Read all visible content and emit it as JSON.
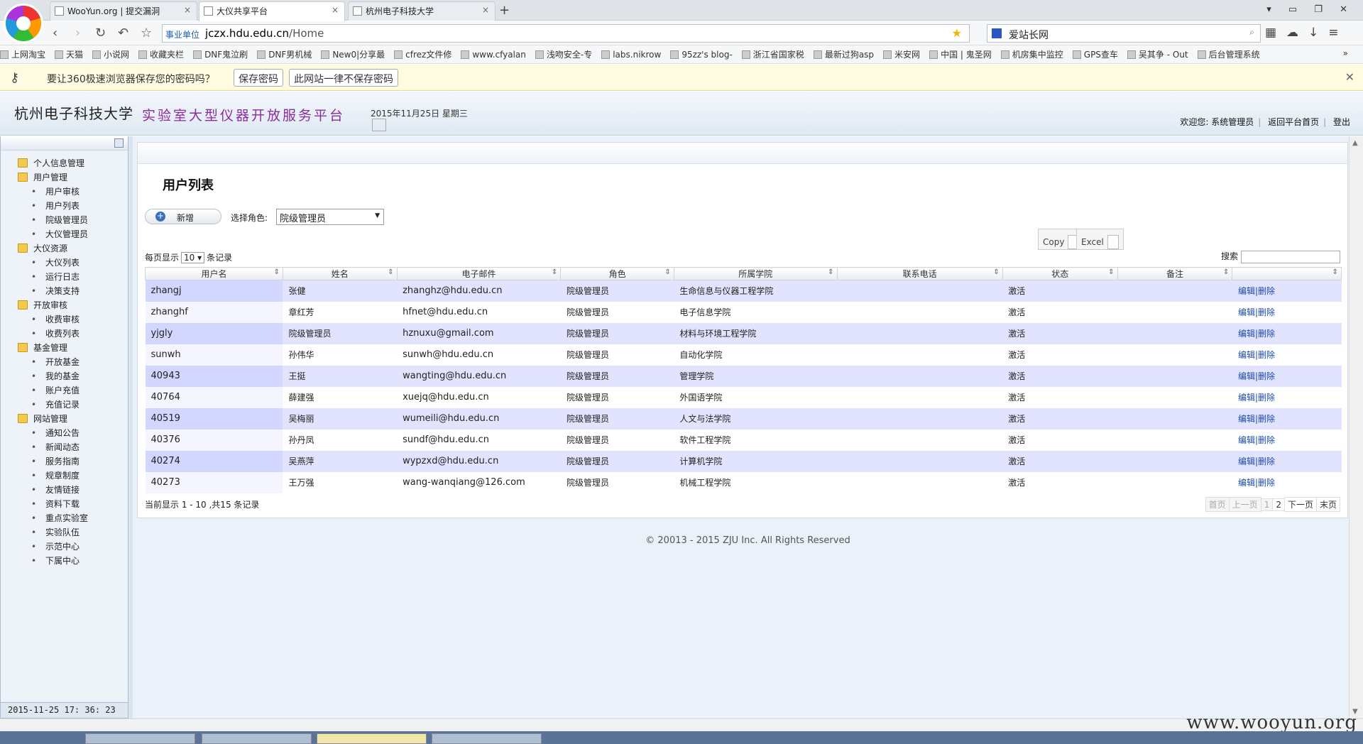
{
  "browser": {
    "tabs": [
      {
        "title": "WooYun.org | 提交漏洞"
      },
      {
        "title": "大仪共享平台"
      },
      {
        "title": "杭州电子科技大学"
      }
    ],
    "url_tag": "事业单位",
    "url_host": "jczx.hdu.edu.cn",
    "url_path": "/Home",
    "search_text": "爱站长网",
    "bookmarks": [
      "上网淘宝",
      "天猫",
      "小说网",
      "收藏夹栏",
      "DNF鬼泣刷",
      "DNF男机械",
      "New0|分享最",
      "cfrez文件修",
      "www.cfyalan",
      "浅吻安全-专",
      "labs.nikrow",
      "95zz's blog-",
      "浙江省国家税",
      "最新过狗asp",
      "米安网",
      "中国 | 鬼圣网",
      "机房集中监控",
      "GPS查车",
      "吴其争 - Out",
      "后台管理系统"
    ],
    "pwd_prompt": "要让360极速浏览器保存您的密码吗？",
    "pwd_save": "保存密码",
    "pwd_never": "此网站一律不保存密码",
    "colors": {
      "tab_bar": "#dfe3e8",
      "prompt_bg": "#fffbe1",
      "row_odd": "#e2e4ff",
      "title_purple": "#8a2d9b"
    }
  },
  "header": {
    "school": "杭州电子科技大学",
    "platform": "实验室大型仪器开放服务平台",
    "date": "2015年11月25日 星期三",
    "welcome": "欢迎您: 系统管理员",
    "home": "返回平台首页",
    "logout": "登出"
  },
  "sidebar": {
    "groups": [
      {
        "label": "个人信息管理",
        "items": []
      },
      {
        "label": "用户管理",
        "items": [
          "用户审核",
          "用户列表",
          "院级管理员",
          "大仪管理员"
        ]
      },
      {
        "label": "大仪资源",
        "items": [
          "大仪列表",
          "运行日志",
          "决策支持"
        ]
      },
      {
        "label": "开放审核",
        "items": [
          "收费审核",
          "收费列表"
        ]
      },
      {
        "label": "基金管理",
        "items": [
          "开放基金",
          "我的基金",
          "账户充值",
          "充值记录"
        ]
      },
      {
        "label": "网站管理",
        "items": [
          "通知公告",
          "新闻动态",
          "服务指南",
          "规章制度",
          "友情链接",
          "资料下载",
          "重点实验室",
          "实验队伍",
          "示范中心",
          "下属中心"
        ]
      }
    ],
    "clock": "2015-11-25   17: 36: 23"
  },
  "main": {
    "title": "用户列表",
    "add_label": "新增",
    "role_label": "选择角色:",
    "role_value": "院级管理员",
    "copy_label": "Copy",
    "excel_label": "Excel",
    "page_len_prefix": "每页显示",
    "page_len_value": "10",
    "page_len_suffix": "条记录",
    "search_label": "搜索",
    "columns": [
      "用户名",
      "姓名",
      "电子邮件",
      "角色",
      "所属学院",
      "联系电话",
      "状态",
      "备注",
      ""
    ],
    "rows": [
      [
        "zhangj",
        "张健",
        "zhanghz@hdu.edu.cn",
        "院级管理员",
        "生命信息与仪器工程学院",
        "",
        "激活",
        "",
        "编辑|删除"
      ],
      [
        "zhanghf",
        "章红芳",
        "hfnet@hdu.edu.cn",
        "院级管理员",
        "电子信息学院",
        "",
        "激活",
        "",
        "编辑|删除"
      ],
      [
        "yjgly",
        "院级管理员",
        "hznuxu@gmail.com",
        "院级管理员",
        "材料与环境工程学院",
        "",
        "激活",
        "",
        "编辑|删除"
      ],
      [
        "sunwh",
        "孙伟华",
        "sunwh@hdu.edu.cn",
        "院级管理员",
        "自动化学院",
        "",
        "激活",
        "",
        "编辑|删除"
      ],
      [
        "40943",
        "王挺",
        "wangting@hdu.edu.cn",
        "院级管理员",
        "管理学院",
        "",
        "激活",
        "",
        "编辑|删除"
      ],
      [
        "40764",
        "薛建强",
        "xuejq@hdu.edu.cn",
        "院级管理员",
        "外国语学院",
        "",
        "激活",
        "",
        "编辑|删除"
      ],
      [
        "40519",
        "吴梅丽",
        "wumeili@hdu.edu.cn",
        "院级管理员",
        "人文与法学院",
        "",
        "激活",
        "",
        "编辑|删除"
      ],
      [
        "40376",
        "孙丹凤",
        "sundf@hdu.edu.cn",
        "院级管理员",
        "软件工程学院",
        "",
        "激活",
        "",
        "编辑|删除"
      ],
      [
        "40274",
        "吴燕萍",
        "wypzxd@hdu.edu.cn",
        "院级管理员",
        "计算机学院",
        "",
        "激活",
        "",
        "编辑|删除"
      ],
      [
        "40273",
        "王万强",
        "wang-wanqiang@126.com",
        "院级管理员",
        "机械工程学院",
        "",
        "激活",
        "",
        "编辑|删除"
      ]
    ],
    "info": "当前显示 1 - 10 ,共15 条记录",
    "pager": [
      "首页",
      "上一页",
      "1",
      "2",
      "下一页",
      "末页"
    ],
    "copyright": "© 20013 - 2015 ZJU Inc. All Rights Reserved"
  },
  "watermark": "www.wooyun.org"
}
